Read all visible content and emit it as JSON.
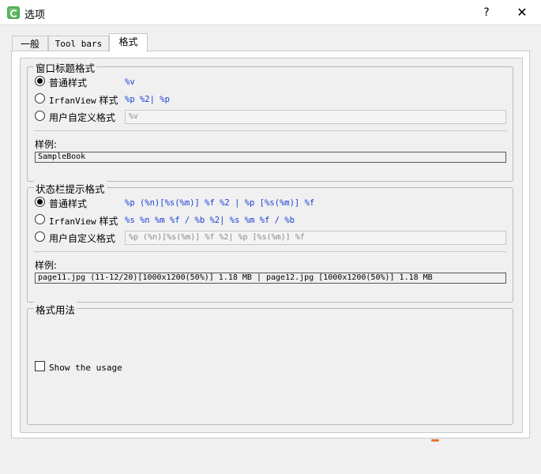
{
  "window": {
    "title": "选项",
    "help_label": "?",
    "close_label": "✕"
  },
  "tabs": [
    {
      "label": "一般"
    },
    {
      "label": "Tool bars"
    },
    {
      "label": "格式"
    }
  ],
  "title_format": {
    "legend": "窗口标题格式",
    "normal_label": "普通样式",
    "normal_value": "%v",
    "irfan_label_latin": "IrfanView",
    "irfan_label_cjk": "样式",
    "irfan_value": "%p %2| %p",
    "custom_label": "用户自定义格式",
    "custom_value": "%v",
    "sample_label": "样例:",
    "sample_value": "SampleBook"
  },
  "status_format": {
    "legend": "状态栏提示格式",
    "normal_label": "普通样式",
    "normal_value": "%p (%n)[%s(%m)] %f %2 | %p [%s(%m)] %f",
    "irfan_label_latin": "IrfanView",
    "irfan_label_cjk": "样式",
    "irfan_value": "%s %n %m %f / %b %2| %s %m %f / %b",
    "custom_label": "用户自定义格式",
    "custom_value": "%p (%n)[%s(%m)] %f %2| %p [%s(%m)] %f",
    "sample_label": "样例:",
    "sample_value": "page11.jpg (11-12/20)[1000x1200(50%)] 1.18 MB | page12.jpg [1000x1200(50%)] 1.18 MB"
  },
  "usage": {
    "legend": "格式用法",
    "checkbox_label": "Show the usage",
    "checked": false
  },
  "colors": {
    "format_text": "#1a3fd6",
    "accent_orange": "#e8772e"
  }
}
